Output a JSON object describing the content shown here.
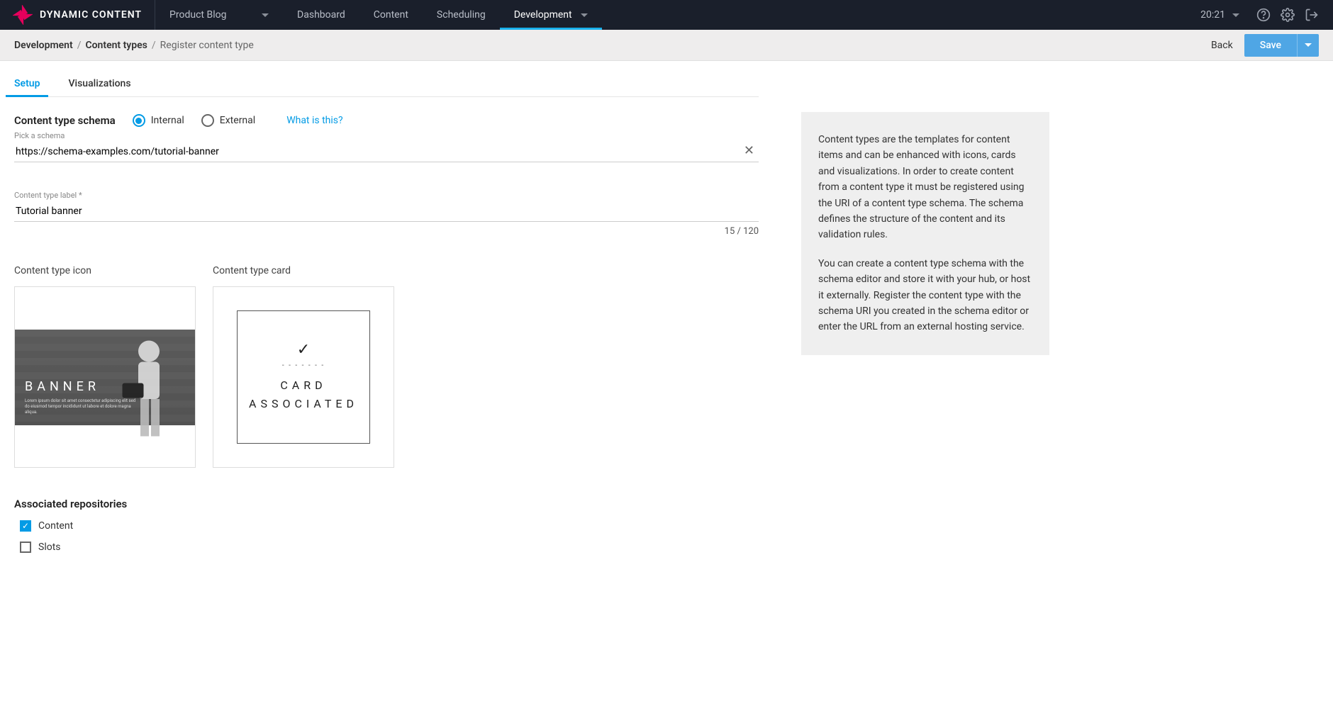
{
  "app": {
    "logo_text": "DYNAMIC CONTENT",
    "hub_name": "Product Blog",
    "time": "20:21"
  },
  "nav": {
    "items": [
      {
        "label": "Dashboard",
        "active": false
      },
      {
        "label": "Content",
        "active": false
      },
      {
        "label": "Scheduling",
        "active": false
      },
      {
        "label": "Development",
        "active": true
      }
    ]
  },
  "breadcrumb": {
    "root": "Development",
    "mid": "Content types",
    "leaf": "Register content type",
    "back": "Back",
    "save": "Save"
  },
  "tabs": {
    "setup": "Setup",
    "visualizations": "Visualizations"
  },
  "form": {
    "schema_heading": "Content type schema",
    "radio_internal": "Internal",
    "radio_external": "External",
    "what_link": "What is this?",
    "schema_hint": "Pick a schema",
    "schema_value": "https://schema-examples.com/tutorial-banner",
    "label_hint": "Content type label *",
    "label_value": "Tutorial banner",
    "char_count": "15 / 120",
    "icon_heading": "Content type icon",
    "card_heading": "Content type card",
    "banner_word": "BANNER",
    "banner_lorem": "Lorem ipsum dolor sit amet consectetur adipiscing elit sed do eiusmod tempor incididunt ut labore et dolore magna aliqua.",
    "card_line1": "CARD",
    "card_line2": "ASSOCIATED"
  },
  "repos": {
    "heading": "Associated repositories",
    "items": [
      {
        "label": "Content",
        "checked": true
      },
      {
        "label": "Slots",
        "checked": false
      }
    ]
  },
  "info": {
    "p1": "Content types are the templates for content items and can be enhanced with icons, cards and visualizations. In order to create content from a content type it must be registered using the URI of a content type schema. The schema defines the structure of the content and its validation rules.",
    "p2": "You can create a content type schema with the schema editor and store it with your hub, or host it externally. Register the content type with the schema URI you created in the schema editor or enter the URL from an external hosting service."
  }
}
